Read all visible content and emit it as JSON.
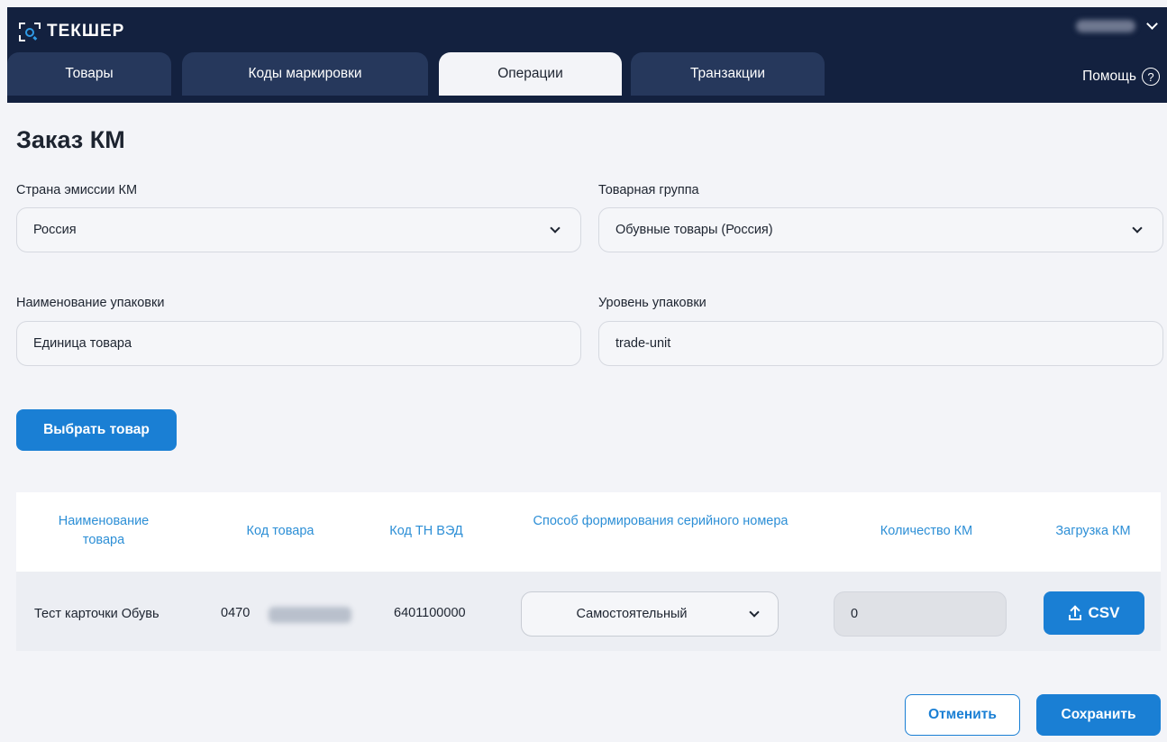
{
  "app": {
    "logo_text": "ТЕКШЕР",
    "user_name": ""
  },
  "nav": {
    "tabs": [
      {
        "label": "Товары"
      },
      {
        "label": "Коды маркировки"
      },
      {
        "label": "Операции"
      },
      {
        "label": "Транзакции"
      }
    ],
    "active_tab": "Операции",
    "help_label": "Помощь",
    "help_icon_glyph": "?"
  },
  "page": {
    "title": "Заказ КМ"
  },
  "form": {
    "country": {
      "label": "Страна эмиссии КМ",
      "value": "Россия"
    },
    "product_group": {
      "label": "Товарная группа",
      "value": "Обувные товары (Россия)"
    },
    "package_name": {
      "label": "Наименование упаковки",
      "value": "Единица товара"
    },
    "package_level": {
      "label": "Уровень упаковки",
      "value": "trade-unit"
    },
    "choose_product_button": "Выбрать товар"
  },
  "table": {
    "columns": [
      "Наименование товара",
      "Код товара",
      "Код ТН ВЭД",
      "Способ формирования серийного номера",
      "Количество КМ",
      "Загрузка КМ"
    ],
    "rows": [
      {
        "name": "Тест карточки Обувь",
        "code_visible": "0470",
        "tnved": "6401100000",
        "serial_method": "Самостоятельный",
        "quantity": "0",
        "upload_label": "CSV"
      }
    ]
  },
  "actions": {
    "cancel_label": "Отменить",
    "save_label": "Сохранить"
  },
  "colors": {
    "header_bg": "#13213f",
    "tab_bg": "#26385c",
    "page_bg": "#f3f4f8",
    "accent": "#1a7fd4",
    "column_header": "#2d8fd6"
  },
  "icons": [
    "logo-icon",
    "user-menu-chevron-icon",
    "help-icon",
    "chevron-down-icon",
    "upload-icon"
  ]
}
